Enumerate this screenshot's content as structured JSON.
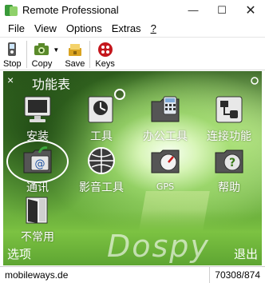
{
  "window": {
    "title": "Remote Professional",
    "minimize": "—",
    "maximize": "☐",
    "close": "✕"
  },
  "menu": {
    "file": "File",
    "view": "View",
    "options": "Options",
    "extras": "Extras",
    "help": "?"
  },
  "toolbar": {
    "stop": "Stop",
    "copy": "Copy",
    "copy_caret": "▼",
    "save": "Save",
    "keys": "Keys"
  },
  "phone": {
    "close_glyph": "×",
    "title": "功能表",
    "items": [
      {
        "label": "安装",
        "icon": "monitor-icon"
      },
      {
        "label": "工具",
        "icon": "tools-icon"
      },
      {
        "label": "办公工具",
        "icon": "office-icon"
      },
      {
        "label": "连接功能",
        "icon": "connectivity-icon"
      },
      {
        "label": "通讯",
        "icon": "messaging-icon"
      },
      {
        "label": "影音工具",
        "icon": "media-icon"
      },
      {
        "label": "GPS",
        "icon": "gps-icon"
      },
      {
        "label": "帮助",
        "icon": "help-icon"
      },
      {
        "label": "不常用",
        "icon": "door-icon"
      }
    ],
    "softkey_left": "选项",
    "softkey_right": "退出",
    "watermark": "Dospy"
  },
  "status": {
    "left": "mobileways.de",
    "right": "70308/874"
  },
  "colors": {
    "accent_green": "#5fa23a",
    "dark_green": "#2c5a1c",
    "text_white": "#ffffff"
  }
}
